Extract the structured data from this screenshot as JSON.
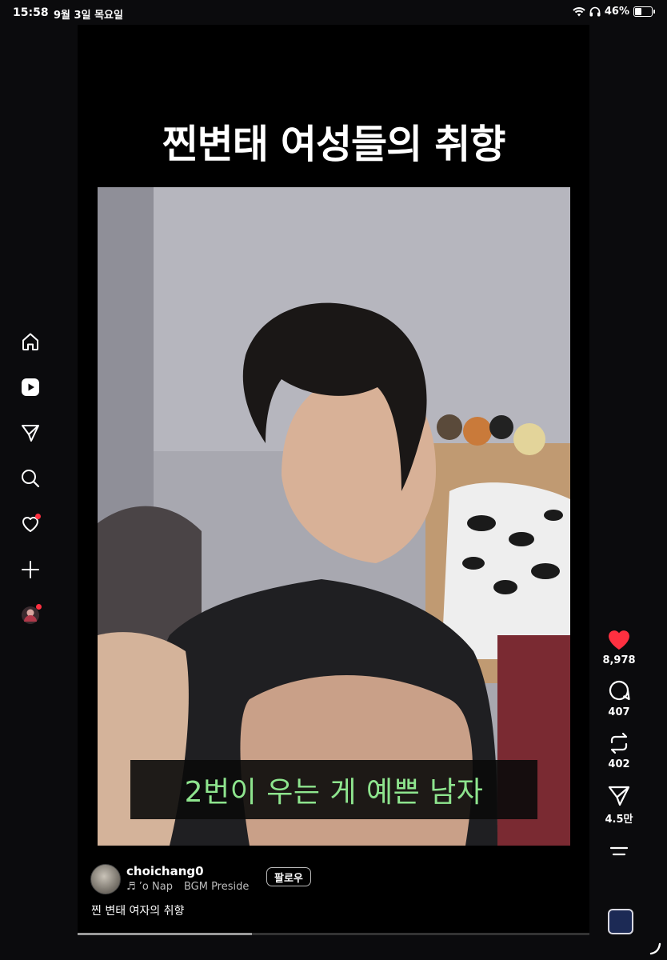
{
  "status_bar": {
    "time": "15:58",
    "date": "9월 3일 목요일",
    "battery": "46%",
    "battery_level": 0.46
  },
  "left_nav": {
    "items": [
      {
        "name": "home",
        "icon": "home-icon"
      },
      {
        "name": "reels",
        "icon": "reels-icon"
      },
      {
        "name": "direct",
        "icon": "send-icon"
      },
      {
        "name": "search",
        "icon": "search-icon"
      },
      {
        "name": "activity",
        "icon": "heart-icon",
        "badge": true
      },
      {
        "name": "create",
        "icon": "plus-icon"
      },
      {
        "name": "profile",
        "icon": "profile-avatar",
        "badge": true
      }
    ]
  },
  "reel": {
    "title": "찐변태 여성들의 취향",
    "subtitle": "2번이 우는 게 예쁜 남자",
    "progress": 0.34,
    "author": {
      "username": "choichang0",
      "audio_track": "♬ ’o Nap",
      "audio_artist": "BGM Preside",
      "follow_label": "팔로우"
    },
    "caption": "찐 변태 여자의 취향"
  },
  "actions": {
    "like_count": "8,978",
    "comment_count": "407",
    "repost_count": "402",
    "share_count": "4.5만"
  },
  "colors": {
    "like": "#ff3040",
    "subtitle_text": "#8ee58e",
    "background": "#0b0b0d"
  }
}
